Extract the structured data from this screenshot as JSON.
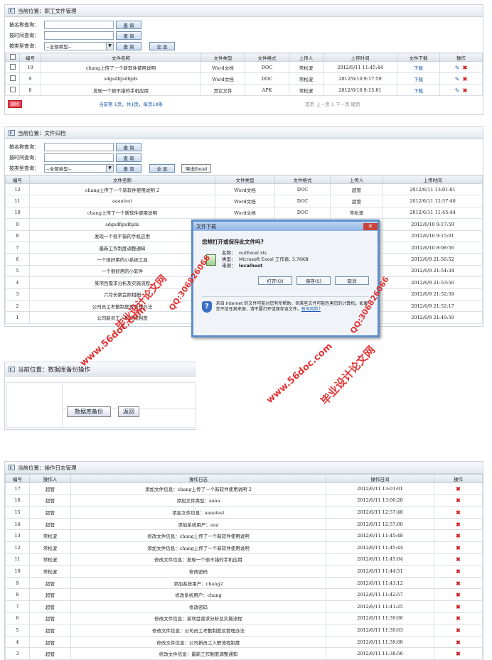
{
  "p1": {
    "loc": "当前位置：职工文件管理",
    "q": {
      "name": "按名称查询：",
      "time": "按时间查询：",
      "type": "按类型查询：",
      "sel": "--全部类型--",
      "search": "查 询",
      "all": "全 显"
    },
    "cols": [
      "编号",
      "文件名称",
      "文件类型",
      "文件格式",
      "上传人",
      "上传时间",
      "文件下载",
      "操作"
    ],
    "rows": [
      [
        "10",
        "chang上传了一个新软件使用说明",
        "Word文档",
        "DOC",
        "常松波",
        "2012/6/11 11:45:44",
        "下载"
      ],
      [
        "9",
        "sdgsdfgsdfgds",
        "Word文档",
        "DOC",
        "常松波",
        "2012/6/10 9:17:59",
        "下载"
      ],
      [
        "8",
        "发现一个很不错的手机应用",
        "其它文件",
        "APK",
        "常松波",
        "2012/6/10 9:15:01",
        "下载"
      ]
    ],
    "delete": "删除",
    "pager": "当前第 1页，共1页，每页18条",
    "nav": "首页 上一页 1 下一页 尾页"
  },
  "p2": {
    "loc": "当前位置：文件归档",
    "export": "导出Excel",
    "cols": [
      "编号",
      "文件名称",
      "文件类型",
      "文件格式",
      "上传人",
      "上传时间"
    ],
    "rows": [
      [
        "12",
        "chang上传了一个新软件使用说明 2",
        "Word文档",
        "DOC",
        "超管",
        "2012/6/11 13:01:01"
      ],
      [
        "11",
        "aaaatest",
        "Word文档",
        "DOC",
        "超管",
        "2012/6/11 12:57:40"
      ],
      [
        "10",
        "chang上传了一个新软件使用说明",
        "Word文档",
        "DOC",
        "常松波",
        "2012/6/11 11:45:44"
      ],
      [
        "9",
        "sdgsdfgsdfgds",
        "",
        "",
        "",
        "2012/6/10 9:17:59"
      ],
      [
        "8",
        "发现一个很不错的手机应用",
        "",
        "",
        "",
        "2012/6/10 9:15:01"
      ],
      [
        "7",
        "最新工作制度调整通知",
        "",
        "",
        "",
        "2012/6/10 8:08:56"
      ],
      [
        "6",
        "一个很好用的小系统工具",
        "",
        "",
        "",
        "2012/6/9 21:56:52"
      ],
      [
        "5",
        "一个很好用的小软件",
        "",
        "",
        "",
        "2012/6/9 21:54:34"
      ],
      [
        "4",
        "某项目需求分析及实施流程",
        "",
        "",
        "",
        "2012/6/9 21:53:56"
      ],
      [
        "3",
        "六月份聚会照相细",
        "",
        "",
        "",
        "2012/6/9 21:52:59"
      ],
      [
        "2",
        "公司员工考勤制度及管理办法",
        "",
        "",
        "",
        "2012/6/9 21:52:17"
      ],
      [
        "1",
        "公司新员工入职流程制度",
        "",
        "",
        "",
        "2012/6/9 21:49:59"
      ]
    ]
  },
  "dialog": {
    "title": "文件下载",
    "question": "您想打开或保存此文件吗?",
    "name_l": "名称：",
    "name": "outExcel.xls",
    "type_l": "类型：",
    "type": "Microsoft Excel 工作表, 3.76KB",
    "from_l": "来源：",
    "from": "localhost",
    "open": "打开(O)",
    "save": "保存(S)",
    "cancel": "取消",
    "warn": "来自 Internet 的文件可能对您有所帮助，但某些文件可能危害您的计算机。如果您不信任其来源，请不要打开或保存该文件。",
    "risk": "有何风险?"
  },
  "p3": {
    "loc": "当前位置：数据库备份操作",
    "backup": "数据库备份",
    "back": "返回"
  },
  "p4": {
    "loc": "当前位置：操作日志管理",
    "cols": [
      "编号",
      "操作人",
      "操作日志",
      "操作日间",
      "操作"
    ],
    "rows": [
      [
        "17",
        "超管",
        "添加文件信息：chang上传了一个新软件使用说明 2",
        "2012/6/11 13:01:01"
      ],
      [
        "16",
        "超管",
        "添加文件类型：aaaa",
        "2012/6/11 13:00:28"
      ],
      [
        "15",
        "超管",
        "添加文件信息：aaaatest",
        "2012/6/11 12:57:40"
      ],
      [
        "14",
        "超管",
        "添加系统用户：aaa",
        "2012/6/11 12:57:00"
      ],
      [
        "13",
        "常松波",
        "修改文件信息：chang上传了一个新软件使用说明",
        "2012/6/11 11:45:48"
      ],
      [
        "12",
        "常松波",
        "添加文件信息：chang上传了一个新软件使用说明",
        "2012/6/11 11:45:44"
      ],
      [
        "11",
        "常松波",
        "修改文件信息：发现一个很不错的手机应用",
        "2012/6/11 11:45:04"
      ],
      [
        "10",
        "常松波",
        "修改密码",
        "2012/6/11 11:44:51"
      ],
      [
        "9",
        "超管",
        "添加系统用户：chang2",
        "2012/6/11 11:43:12"
      ],
      [
        "8",
        "超管",
        "修改系统用户：chang",
        "2012/6/11 11:42:57"
      ],
      [
        "7",
        "超管",
        "修改密码",
        "2012/6/11 11:41:25"
      ],
      [
        "6",
        "超管",
        "修改文件信息：某项目需求分析及实施流程",
        "2012/6/11 11:39:06"
      ],
      [
        "5",
        "超管",
        "修改文件信息：公司员工考勤制度及管理办法",
        "2012/6/11 11:39:03"
      ],
      [
        "4",
        "超管",
        "修改文件信息：公司新员工入职流程制度",
        "2012/6/11 11:39:00"
      ],
      [
        "3",
        "超管",
        "修改文件信息：最新工作制度调整通知",
        "2012/6/11 11:38:56"
      ]
    ]
  },
  "watermarks": {
    "site": "www.56doc.com",
    "qq": "QQ:306826066",
    "brand": "毕业设计论文网"
  },
  "colors": {
    "link": "#1a5bb0",
    "delete": "#d02020",
    "watermark": "#e02020"
  }
}
